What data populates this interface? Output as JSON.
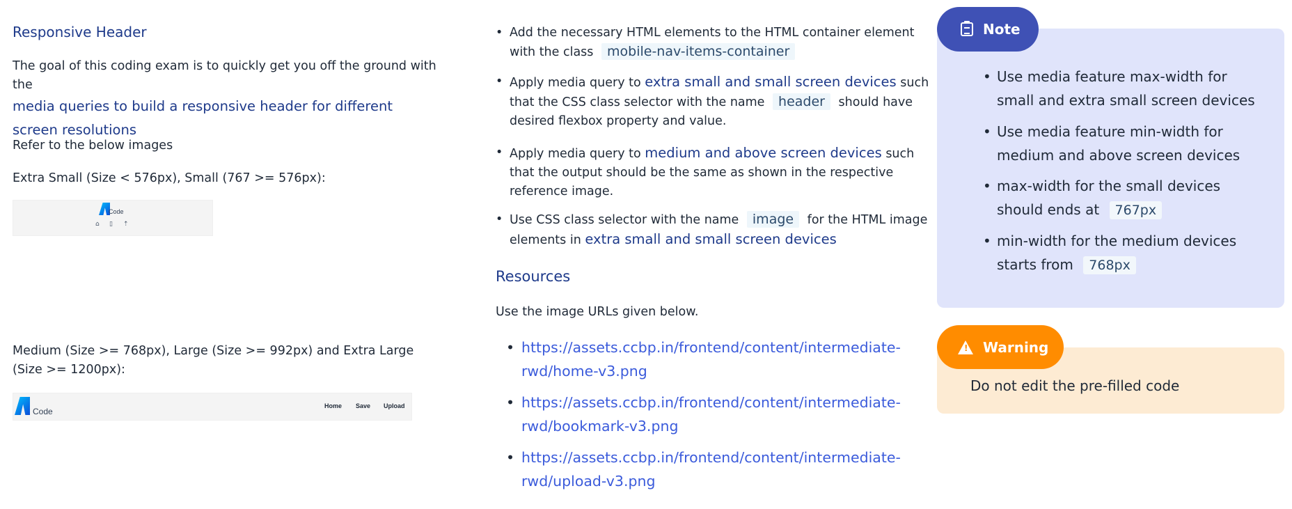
{
  "left": {
    "title": "Responsive Header",
    "intro_plain": "The goal of this coding exam is to quickly get you off the ground with the",
    "intro_highlight": "media queries to build a responsive header for different screen resolutions",
    "refer": "Refer to the below images",
    "extra_small_label": "Extra Small (Size < 576px), Small (767 >= 576px):",
    "medium_label": "Medium (Size >= 768px), Large (Size >= 992px) and Extra Large (Size >= 1200px):",
    "preview_logo_text": "Code",
    "preview_nav": [
      "Home",
      "Save",
      "Upload"
    ]
  },
  "middle": {
    "items": [
      {
        "a": "Add the necessary HTML elements to the HTML container element with the class",
        "code": "mobile-nav-items-container"
      },
      {
        "a": "Apply media query to",
        "b": "extra small and small screen devices",
        "c": "such that the CSS class selector with the name",
        "code": "header",
        "d": "should have desired flexbox property and value."
      },
      {
        "a": "Apply media query to",
        "b": "medium and above screen devices",
        "c": "such that the output should be the same as shown in the respective reference image."
      },
      {
        "a": "Use CSS class selector with the name",
        "code": "image",
        "c": "for the HTML image elements in",
        "b": "extra small and small screen devices"
      }
    ],
    "resources_title": "Resources",
    "resources_intro": "Use the image URLs given below.",
    "links": [
      "https://assets.ccbp.in/frontend/content/intermediate-rwd/home-v3.png",
      "https://assets.ccbp.in/frontend/content/intermediate-rwd/bookmark-v3.png",
      "https://assets.ccbp.in/frontend/content/intermediate-rwd/upload-v3.png"
    ]
  },
  "note": {
    "label": "Note",
    "items": [
      {
        "text": "Use media feature max-width for small and extra small screen devices"
      },
      {
        "text": "Use media feature min-width for medium and above screen devices"
      },
      {
        "text": "max-width for the small devices should ends at",
        "code": "767px"
      },
      {
        "text": "min-width for the medium devices starts from",
        "code": "768px"
      }
    ]
  },
  "warning": {
    "label": "Warning",
    "text": "Do not edit the pre-filled code"
  },
  "colors": {
    "note_accent": "#3f51b5",
    "note_bg": "#e0e4fb",
    "warning_accent": "#ff8c00",
    "warning_bg": "#fdebd3",
    "link": "#3b5bdb"
  }
}
